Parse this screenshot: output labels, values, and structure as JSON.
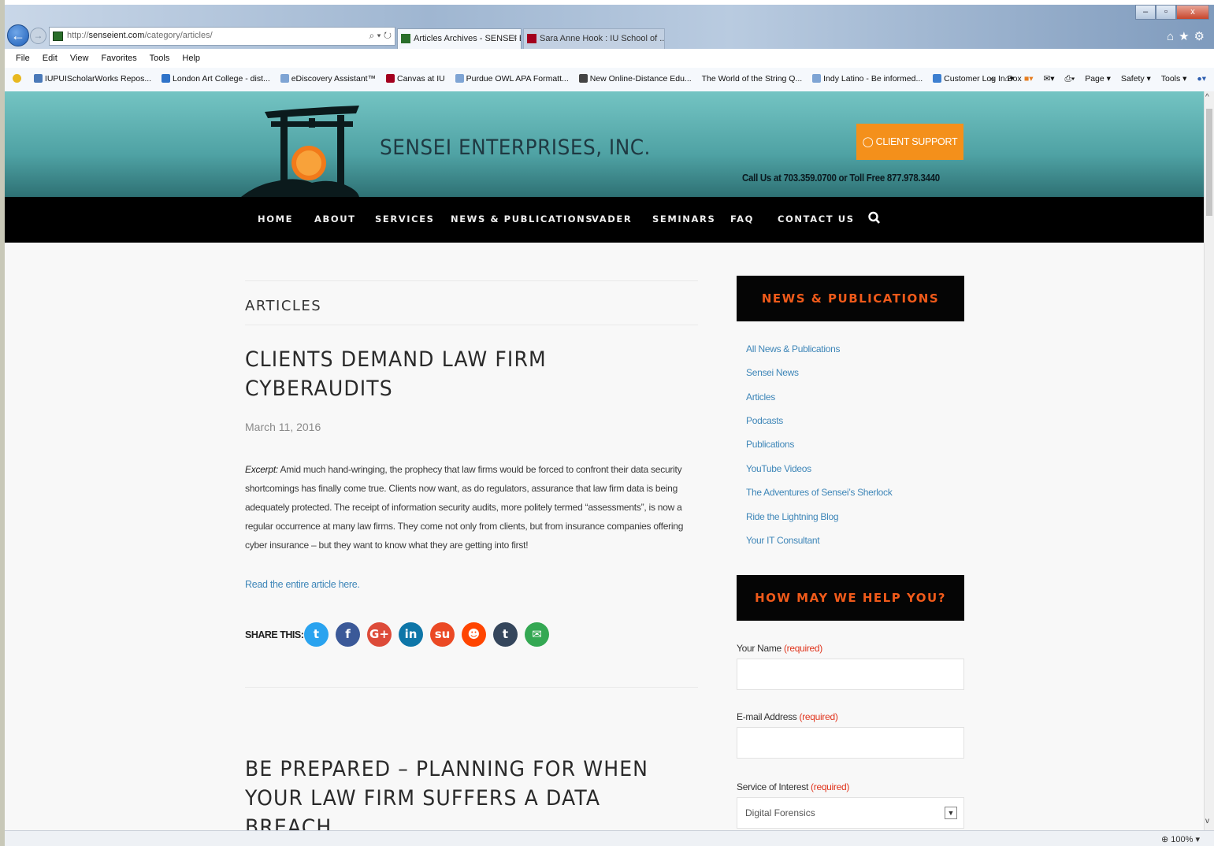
{
  "browser": {
    "url_prefix": "http://",
    "url_domain": "senseient.com",
    "url_path": "/category/articles/",
    "address_icons": "⌕ ▾ ↻",
    "tabs": [
      {
        "title": "Articles Archives - SENSEI E...",
        "close": "×"
      },
      {
        "title": "Sara Anne Hook : IU School of ..."
      }
    ],
    "menu": [
      "File",
      "Edit",
      "View",
      "Favorites",
      "Tools",
      "Help"
    ],
    "favorites": [
      "IUPUIScholarWorks Repos...",
      "London Art College - dist...",
      "eDiscovery Assistant™",
      "Canvas at IU",
      "Purdue OWL APA Formatt...",
      "New Online-Distance Edu...",
      "The World of the String Q...",
      "Indy Latino - Be informed...",
      "Customer Log In  Box"
    ],
    "favbar_overflow": "»",
    "command_bar": [
      "Page ▾",
      "Safety ▾",
      "Tools ▾"
    ],
    "zoom": "100%",
    "window_buttons": [
      "–",
      "▫",
      "x"
    ]
  },
  "site": {
    "title": "SENSEI ENTERPRISES, INC.",
    "support_button": "CLIENT SUPPORT",
    "phone": "Call Us at 703.359.0700 or Toll Free 877.978.3440",
    "nav": [
      "HOME",
      "ABOUT",
      "SERVICES",
      "NEWS & PUBLICATIONS",
      "VADER",
      "SEMINARS",
      "FAQ",
      "CONTACT US"
    ]
  },
  "main": {
    "section_title": "ARTICLES",
    "post1": {
      "title_line1": "CLIENTS DEMAND LAW FIRM",
      "title_line2": "CYBERAUDITS",
      "date": "March 11, 2016",
      "excerpt_label": "Excerpt:",
      "excerpt": " Amid much hand-wringing, the prophecy that law firms would be forced to confront their data security shortcomings has finally come true. Clients now want, as do regulators, assurance that law firm data is being adequately protected. The receipt of information security audits, more politely termed “assessments”, is now a regular occurrence at many law firms. They come not only from clients, but from insurance companies offering cyber insurance – but they want to know what they are getting into first!",
      "read_more": "Read the entire article here.",
      "share_label": "SHARE THIS:"
    },
    "post2": {
      "title_line1": "BE PREPARED – PLANNING FOR WHEN",
      "title_line2": "YOUR LAW FIRM SUFFERS A DATA BREACH"
    }
  },
  "sidebar": {
    "news_heading": "NEWS & PUBLICATIONS",
    "links": [
      "All News & Publications",
      "Sensei News",
      "Articles",
      "Podcasts",
      "Publications",
      "YouTube Videos",
      "The Adventures of Sensei’s Sherlock",
      "Ride the Lightning Blog",
      "Your IT Consultant"
    ],
    "help_heading": "HOW MAY WE HELP YOU?",
    "form": {
      "name_label": "Your Name ",
      "email_label": "E-mail Address ",
      "service_label": "Service of Interest ",
      "required": "(required)",
      "service_value": "Digital Forensics"
    }
  },
  "colors": {
    "header_teal": "#4fa2a4",
    "support_orange": "#f4901b",
    "sidebar_heading_orange": "#f05a1a",
    "link_blue": "#3e86b8",
    "required_red": "#e0341c"
  },
  "share_icons": [
    {
      "name": "twitter-icon",
      "glyph": "t",
      "color": "#2aa3ef"
    },
    {
      "name": "facebook-icon",
      "glyph": "f",
      "color": "#3b5998"
    },
    {
      "name": "google-plus-icon",
      "glyph": "G+",
      "color": "#dd4b39"
    },
    {
      "name": "linkedin-icon",
      "glyph": "in",
      "color": "#0e76a8"
    },
    {
      "name": "stumbleupon-icon",
      "glyph": "su",
      "color": "#eb4924"
    },
    {
      "name": "reddit-icon",
      "glyph": "☻",
      "color": "#ff4500"
    },
    {
      "name": "tumblr-icon",
      "glyph": "t",
      "color": "#35465c"
    },
    {
      "name": "email-icon",
      "glyph": "✉",
      "color": "#34a853"
    }
  ]
}
